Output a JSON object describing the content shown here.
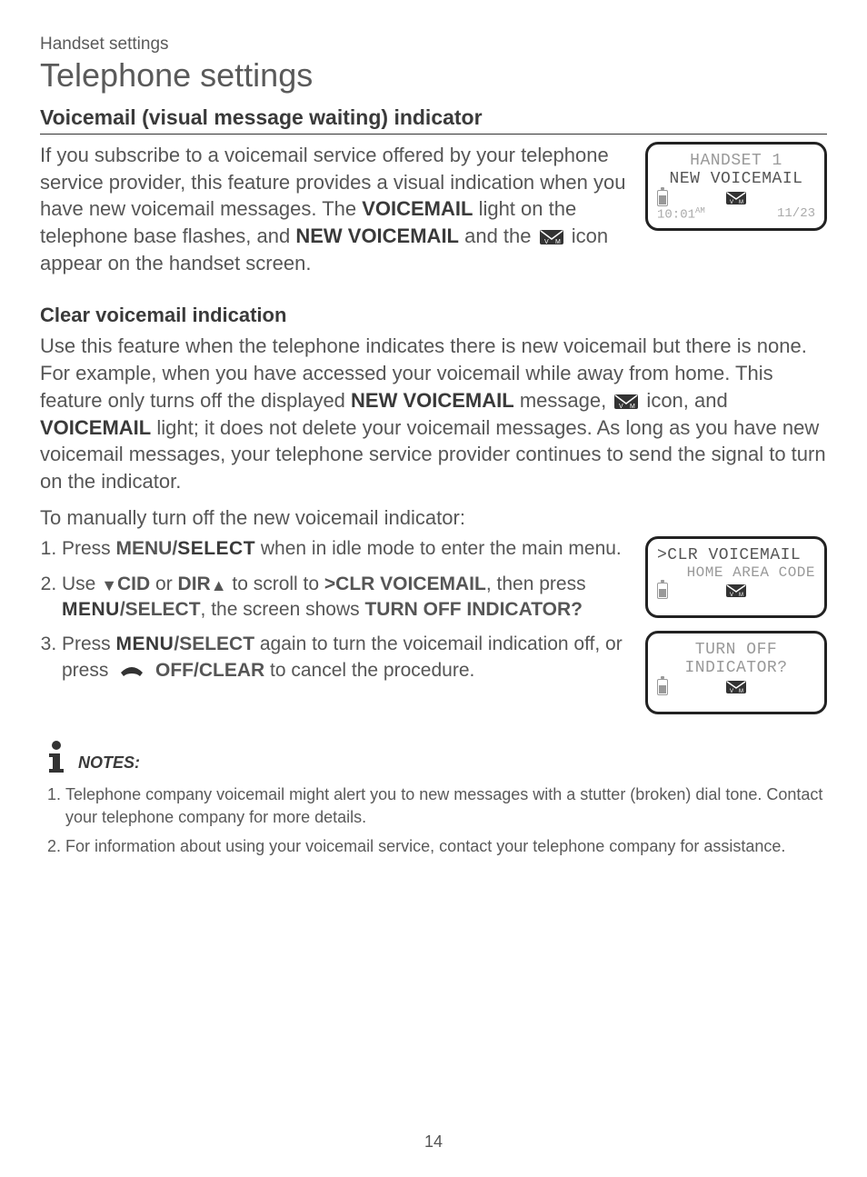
{
  "breadcrumb": "Handset settings",
  "page_title": "Telephone settings",
  "section1": {
    "heading": "Voicemail (visual message waiting) indicator",
    "p1_a": "If you subscribe to a voicemail service offered by your telephone service provider, this feature provides a visual indication when you have new voicemail messages. The ",
    "p1_b": "VOICEMAIL",
    "p1_c": " light on the telephone base flashes, and ",
    "p1_d": "NEW VOICEMAIL",
    "p1_e": " and the ",
    "p1_f": " icon appear on the handset screen."
  },
  "section2": {
    "heading": "Clear voicemail indication",
    "p1_a": "Use this feature when the telephone indicates there is new voicemail but there is none. For example, when you have accessed your voicemail while away from home. This feature only turns off the displayed ",
    "p1_b": "NEW VOICEMAIL",
    "p1_c": " message, ",
    "p1_d": " icon, and ",
    "p1_e": "VOICEMAIL",
    "p1_f": " light; it does not delete your voicemail messages. As long as you have new voicemail messages, your telephone service provider continues to send the signal to turn on the indicator.",
    "p2": "To manually turn off the new voicemail indicator:"
  },
  "steps": {
    "s1_a": "Press ",
    "s1_b": "MENU/",
    "s1_c": "SELECT",
    "s1_d": " when in idle mode to enter the main menu.",
    "s2_a": "Use ",
    "s2_b": "CID",
    "s2_c": " or ",
    "s2_d": "DIR",
    "s2_e": " to scroll to ",
    "s2_f": ">CLR VOICEMAIL",
    "s2_g": ", then press ",
    "s2_h": "MENU",
    "s2_i": "/SELECT",
    "s2_j": ", the screen shows ",
    "s2_k": "TURN OFF INDICATOR?",
    "s3_a": "Press ",
    "s3_b": "MENU",
    "s3_c": "/SELECT",
    "s3_d": " again to turn the voicemail indication off, or press ",
    "s3_e": " OFF/CLEAR",
    "s3_f": " to cancel the procedure."
  },
  "lcd1": {
    "line1": "HANDSET 1",
    "line2": "NEW VOICEMAIL",
    "time": "10:01",
    "ampm": "AM",
    "date": "11/23"
  },
  "lcd2": {
    "line1": ">CLR VOICEMAIL",
    "line2": "HOME AREA CODE"
  },
  "lcd3": {
    "line1": "TURN OFF",
    "line2": "INDICATOR?"
  },
  "notes": {
    "label": "NOTES:",
    "n1": "Telephone company voicemail might alert you to new messages with a stutter (broken) dial tone. Contact your telephone company for more details.",
    "n2": "For information about using your voicemail service, contact your telephone company for assistance."
  },
  "page_number": "14"
}
